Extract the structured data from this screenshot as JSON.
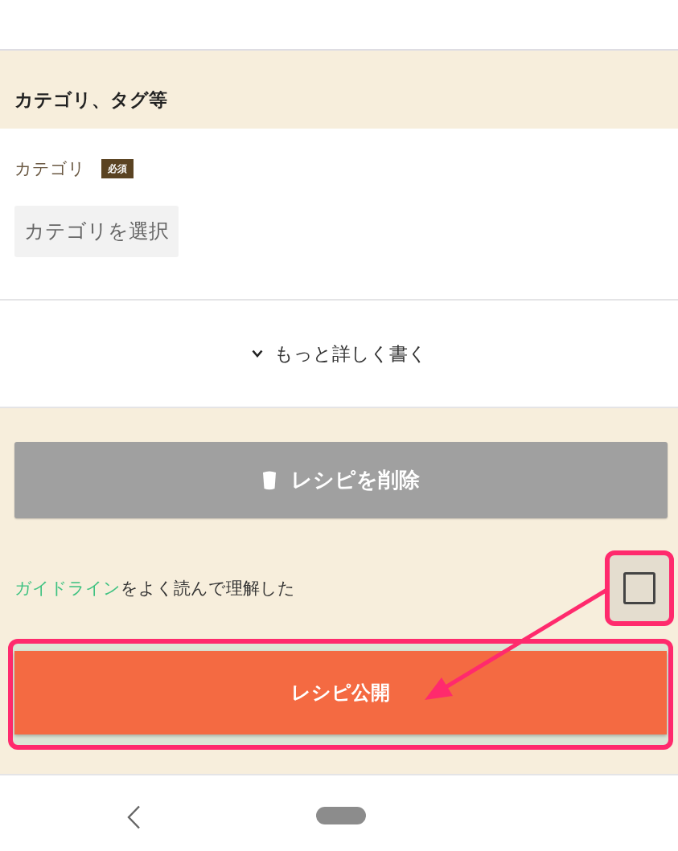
{
  "section_header": {
    "title": "カテゴリ、タグ等"
  },
  "category": {
    "label": "カテゴリ",
    "badge": "必須",
    "select_button": "カテゴリを選択"
  },
  "expand_toggle": {
    "label": "もっと詳しく書く",
    "expanded": false
  },
  "delete_button": {
    "label": "レシピを削除"
  },
  "guideline": {
    "link": "ガイドライン",
    "text": "をよく読んで理解した",
    "checked": false,
    "highlighted": true
  },
  "publish_button": {
    "label": "レシピ公開",
    "highlighted": true
  },
  "annotation_arrow": true
}
